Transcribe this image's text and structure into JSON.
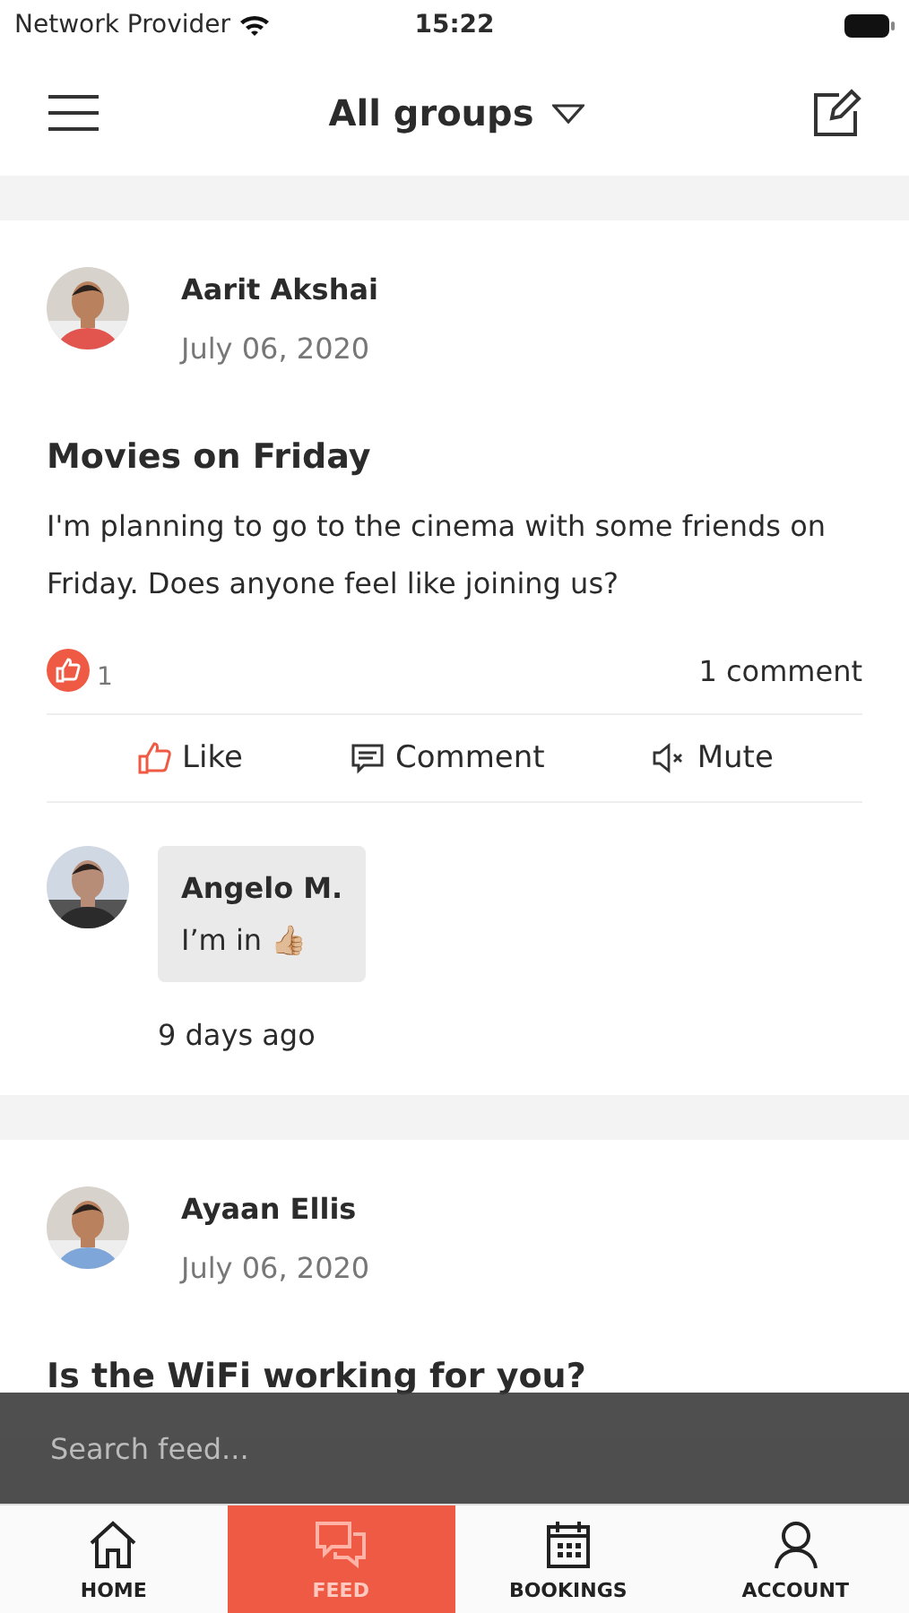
{
  "status_bar": {
    "carrier": "Network Provider",
    "time": "15:22"
  },
  "header": {
    "title": "All groups"
  },
  "posts": [
    {
      "author": "Aarit Akshai",
      "date": "July 06, 2020",
      "title": "Movies on Friday",
      "body": "I'm planning to go to the cinema with some friends on Friday. Does anyone feel like joining us?",
      "liked": true,
      "like_count": "1",
      "comment_count": "1 comment",
      "actions": [
        {
          "kind": "like",
          "label": "Like"
        },
        {
          "kind": "comment",
          "label": "Comment"
        },
        {
          "kind": "mute",
          "label": "Mute"
        }
      ],
      "comments": [
        {
          "author": "Angelo M.",
          "text": "I’m in 👍🏼",
          "time": "9 days ago"
        }
      ]
    },
    {
      "author": "Ayaan Ellis",
      "date": "July 06, 2020",
      "title": "Is the WiFi working for you?"
    }
  ],
  "search": {
    "placeholder": "Search feed..."
  },
  "tabs": [
    {
      "kind": "home",
      "label": "HOME",
      "selected": false
    },
    {
      "kind": "feed",
      "label": "FEED",
      "selected": true
    },
    {
      "kind": "bookings",
      "label": "BOOKINGS",
      "selected": false
    },
    {
      "kind": "account",
      "label": "ACCOUNT",
      "selected": false
    }
  ]
}
